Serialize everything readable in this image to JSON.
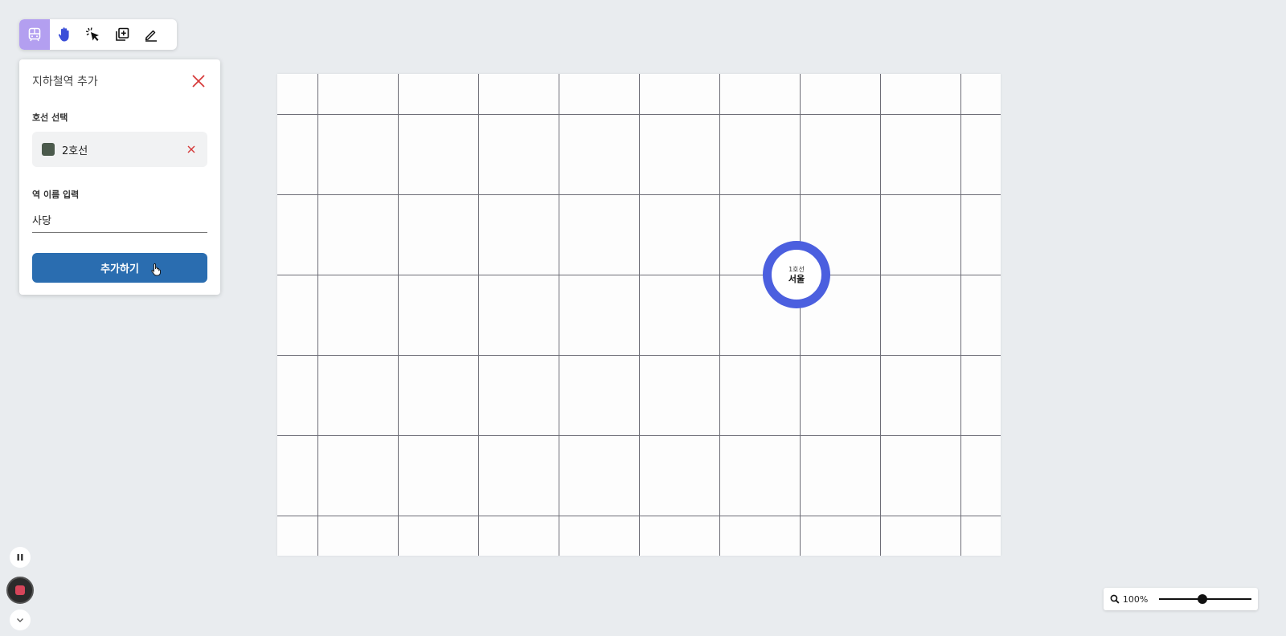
{
  "toolbar": {
    "tools": [
      {
        "icon": "train-icon",
        "active": true
      },
      {
        "icon": "hand-icon",
        "active": false
      },
      {
        "icon": "pointer-click-icon",
        "active": false
      },
      {
        "icon": "add-layer-icon",
        "active": false
      },
      {
        "icon": "pencil-icon",
        "active": false
      }
    ],
    "active_color": "#b39ff0"
  },
  "panel": {
    "title": "지하철역 추가",
    "line_label": "호선 선택",
    "selected_line": {
      "name": "2호선",
      "color": "#4b5a4c"
    },
    "name_label": "역 이름 입력",
    "name_value": "사당",
    "submit_label": "추가하기",
    "button_color": "#2a6db0",
    "close_color": "#d63b3b"
  },
  "canvas": {
    "stations": [
      {
        "line": "1호선",
        "name": "서울",
        "color": "#4b5fdf"
      }
    ]
  },
  "zoom": {
    "label": "100%",
    "level": 0.47
  }
}
